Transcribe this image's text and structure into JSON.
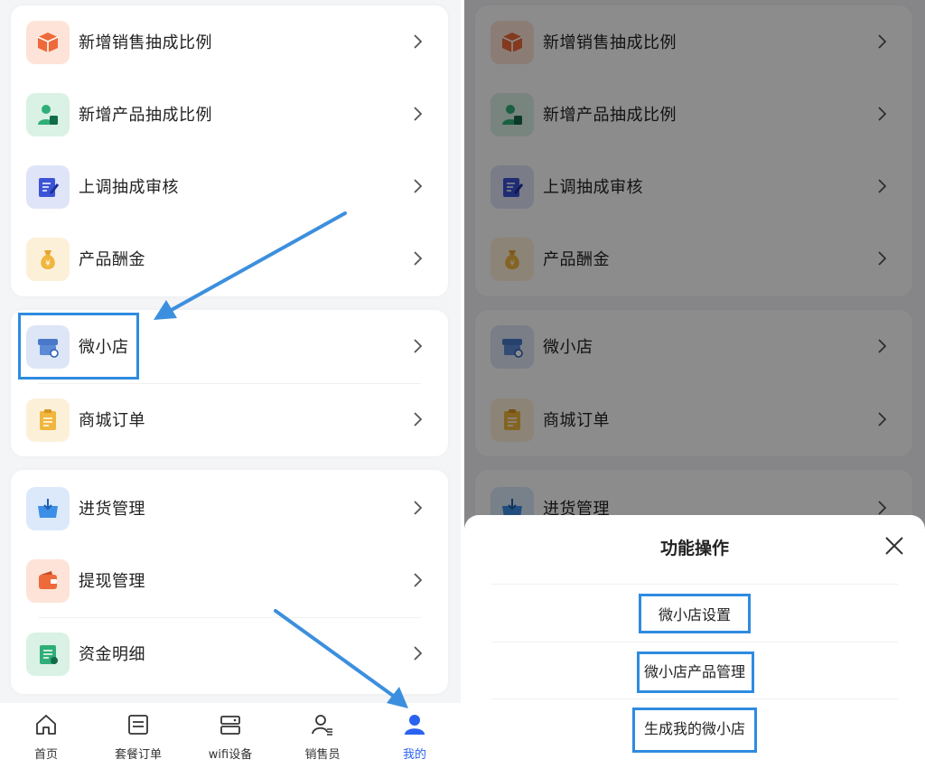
{
  "left_menu": {
    "group1": [
      {
        "label": "新增销售抽成比例",
        "icon": "box-icon",
        "bg": "#fde3d8"
      },
      {
        "label": "新增产品抽成比例",
        "icon": "person-icon",
        "bg": "#daf1e5"
      },
      {
        "label": "上调抽成审核",
        "icon": "edit-document-icon",
        "bg": "#dfe4f8"
      },
      {
        "label": "产品酬金",
        "icon": "money-bag-icon",
        "bg": "#fdf0d9"
      }
    ],
    "group2": [
      {
        "label": "微小店",
        "icon": "shop-icon",
        "bg": "#dde6f6"
      },
      {
        "label": "商城订单",
        "icon": "clipboard-icon",
        "bg": "#fdf0d9"
      }
    ],
    "group3": [
      {
        "label": "进货管理",
        "icon": "basket-icon",
        "bg": "#dbe9fb"
      },
      {
        "label": "提现管理",
        "icon": "wallet-icon",
        "bg": "#fde3d8"
      },
      {
        "label": "资金明细",
        "icon": "ledger-icon",
        "bg": "#daf1e5"
      }
    ]
  },
  "tabbar": [
    {
      "label": "首页",
      "icon": "home-icon"
    },
    {
      "label": "套餐订单",
      "icon": "order-list-icon"
    },
    {
      "label": "wifi设备",
      "icon": "router-icon"
    },
    {
      "label": "销售员",
      "icon": "salesperson-icon"
    },
    {
      "label": "我的",
      "icon": "profile-icon",
      "active": true
    }
  ],
  "sheet": {
    "title": "功能操作",
    "items": [
      "微小店设置",
      "微小店产品管理",
      "生成我的微小店"
    ]
  },
  "colors": {
    "accent": "#2a62f0",
    "highlight": "#2e8be0"
  }
}
